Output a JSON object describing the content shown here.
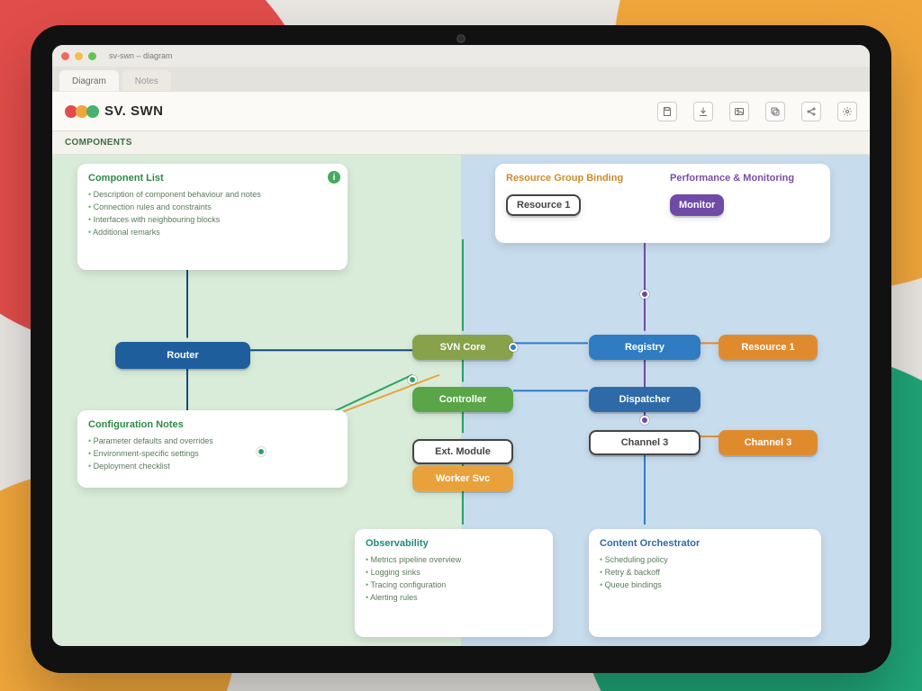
{
  "window": {
    "titlebar_hint": "sv-swn – diagram",
    "tabs": [
      {
        "label": "Diagram",
        "active": true
      },
      {
        "label": "Notes",
        "active": false
      }
    ]
  },
  "brand": {
    "name": "SV. SWN"
  },
  "subheader": {
    "label": "COMPONENTS"
  },
  "toolbar_icons": [
    "save-icon",
    "export-icon",
    "image-icon",
    "copy-icon",
    "share-icon",
    "settings-icon"
  ],
  "cards": {
    "topLeft": {
      "title": "Component List",
      "bullets": [
        "Description of component behaviour and notes",
        "Connection rules and constraints",
        "Interfaces with neighbouring blocks",
        "Additional remarks"
      ]
    },
    "midLeft": {
      "title": "Configuration Notes",
      "bullets": [
        "Parameter defaults and overrides",
        "Environment-specific settings",
        "Deployment checklist"
      ]
    },
    "topRight": {
      "title_a": "Resource Group Binding",
      "title_b": "Performance & Monitoring"
    },
    "botLeft": {
      "title": "Observability",
      "bullets": [
        "Metrics pipeline overview",
        "Logging sinks",
        "Tracing configuration",
        "Alerting rules"
      ]
    },
    "botRight": {
      "title": "Content Orchestrator",
      "bullets": [
        "Scheduling policy",
        "Retry & backoff",
        "Queue bindings"
      ]
    }
  },
  "nodes": {
    "router": {
      "label": "Router"
    },
    "svnCore": {
      "label": "SVN Core"
    },
    "controller": {
      "label": "Controller"
    },
    "extModule": {
      "label": "Ext. Module"
    },
    "workerSvc": {
      "label": "Worker Svc"
    },
    "registry": {
      "label": "Registry"
    },
    "dispatcher": {
      "label": "Dispatcher"
    },
    "monitorBtn": {
      "label": "Monitor"
    },
    "resourceBadge": {
      "label": "Resource 1"
    },
    "channelBadge": {
      "label": "Channel 3"
    }
  }
}
